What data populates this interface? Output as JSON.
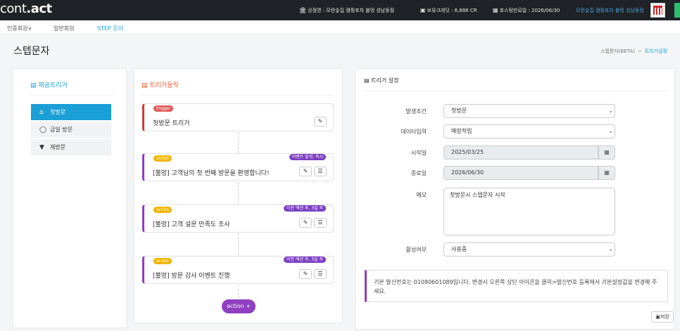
{
  "app": {
    "logo_prefix": "cont",
    "logo_suffix": ".act"
  },
  "topbar": {
    "store": "상점명 : 모란숯집 캠핑포차 불멍 성남동점",
    "credit": "보유크레딧 : 6,888 CR",
    "hosting": "호스팅만료일 : 2026/06/30",
    "store_link": "모란숯집 캠핑포차 불멍 성남동점"
  },
  "nav": {
    "items": [
      "인증회원∨",
      "일반회원",
      "STEP 문자"
    ]
  },
  "page": {
    "title": "스텝문자",
    "crumb_parent": "스텝문자(BETA)",
    "crumb_current": "트리거설정"
  },
  "triggers": {
    "heading": "제공트리거",
    "items": [
      "첫방문",
      "금일 방문",
      "재방문"
    ]
  },
  "actions": {
    "heading": "트리거동작",
    "trigger_card": {
      "pill": "trigger",
      "text": "첫방문 트리거"
    },
    "action_cards": [
      {
        "pill": "action",
        "tag": "이벤트 발생, 즉시",
        "text": "[불멍] 고객님의 첫 번째 방문을 환영합니다!"
      },
      {
        "pill": "action",
        "tag": "이전 액션 후, 3일 후",
        "text": "[불멍] 고객 설문 만족도 조사"
      },
      {
        "pill": "action",
        "tag": "이전 액션 후, 3일 후",
        "text": "[불멍] 방문 감사 이벤트 진행"
      }
    ],
    "add_button": "action +"
  },
  "settings": {
    "heading": "트리거 설정",
    "labels": {
      "condition": "발생조건",
      "data_input": "데이터입력",
      "start": "시작일",
      "end": "종료일",
      "memo": "메모",
      "active": "활성여부"
    },
    "values": {
      "condition": "첫방문",
      "data_input": "매장적립",
      "start": "2025/03/25",
      "end": "2026/06/30",
      "memo": "첫방문시 스텝문자 시작",
      "active": "사용중"
    },
    "notice": "기본 발신번호는 01080601089입니다. 변경시 오른쪽 상단 아이콘을 클릭>발신번호 등록에서 기본설정값을 변경해 주세요.",
    "save": "저장"
  }
}
